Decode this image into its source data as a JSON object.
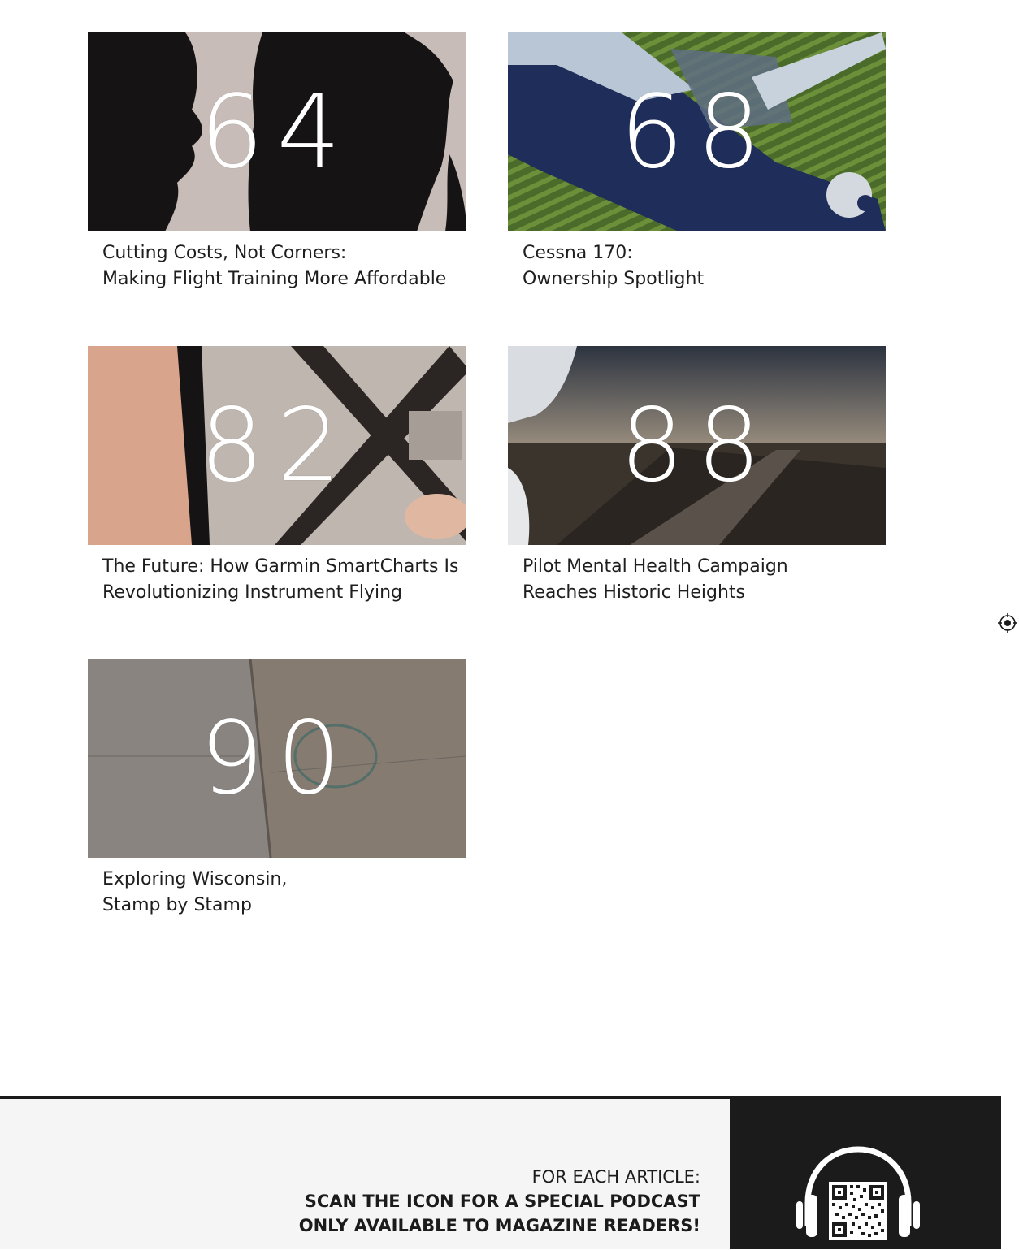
{
  "articles": [
    {
      "page": "64",
      "title_line1": "Cutting Costs, Not Corners:",
      "title_line2": "Making Flight Training More Affordable",
      "image": "silhouette-instructor-student"
    },
    {
      "page": "68",
      "title_line1": "Cessna 170:",
      "title_line2": "Ownership Spotlight",
      "image": "cessna-170-in-flight"
    },
    {
      "page": "82",
      "title_line1": "The Future: How Garmin SmartCharts Is",
      "title_line2": "Revolutionizing Instrument Flying",
      "image": "airport-chart-in-hand"
    },
    {
      "page": "88",
      "title_line1": "Pilot Mental Health Campaign",
      "title_line2": "Reaches Historic Heights",
      "image": "runway-takeoff"
    },
    {
      "page": "90",
      "title_line1": "Exploring Wisconsin,",
      "title_line2": "Stamp by Stamp",
      "image": "passport-stamp-book"
    }
  ],
  "footer": {
    "lead": "FOR EACH ARTICLE:",
    "line1": "SCAN THE ICON FOR A SPECIAL PODCAST",
    "line2": "ONLY AVAILABLE TO MAGAZINE READERS!",
    "icon": "headphones-qr-icon"
  },
  "colors": {
    "footer_dark": "#1b1b1b",
    "number_white": "#ffffff"
  }
}
